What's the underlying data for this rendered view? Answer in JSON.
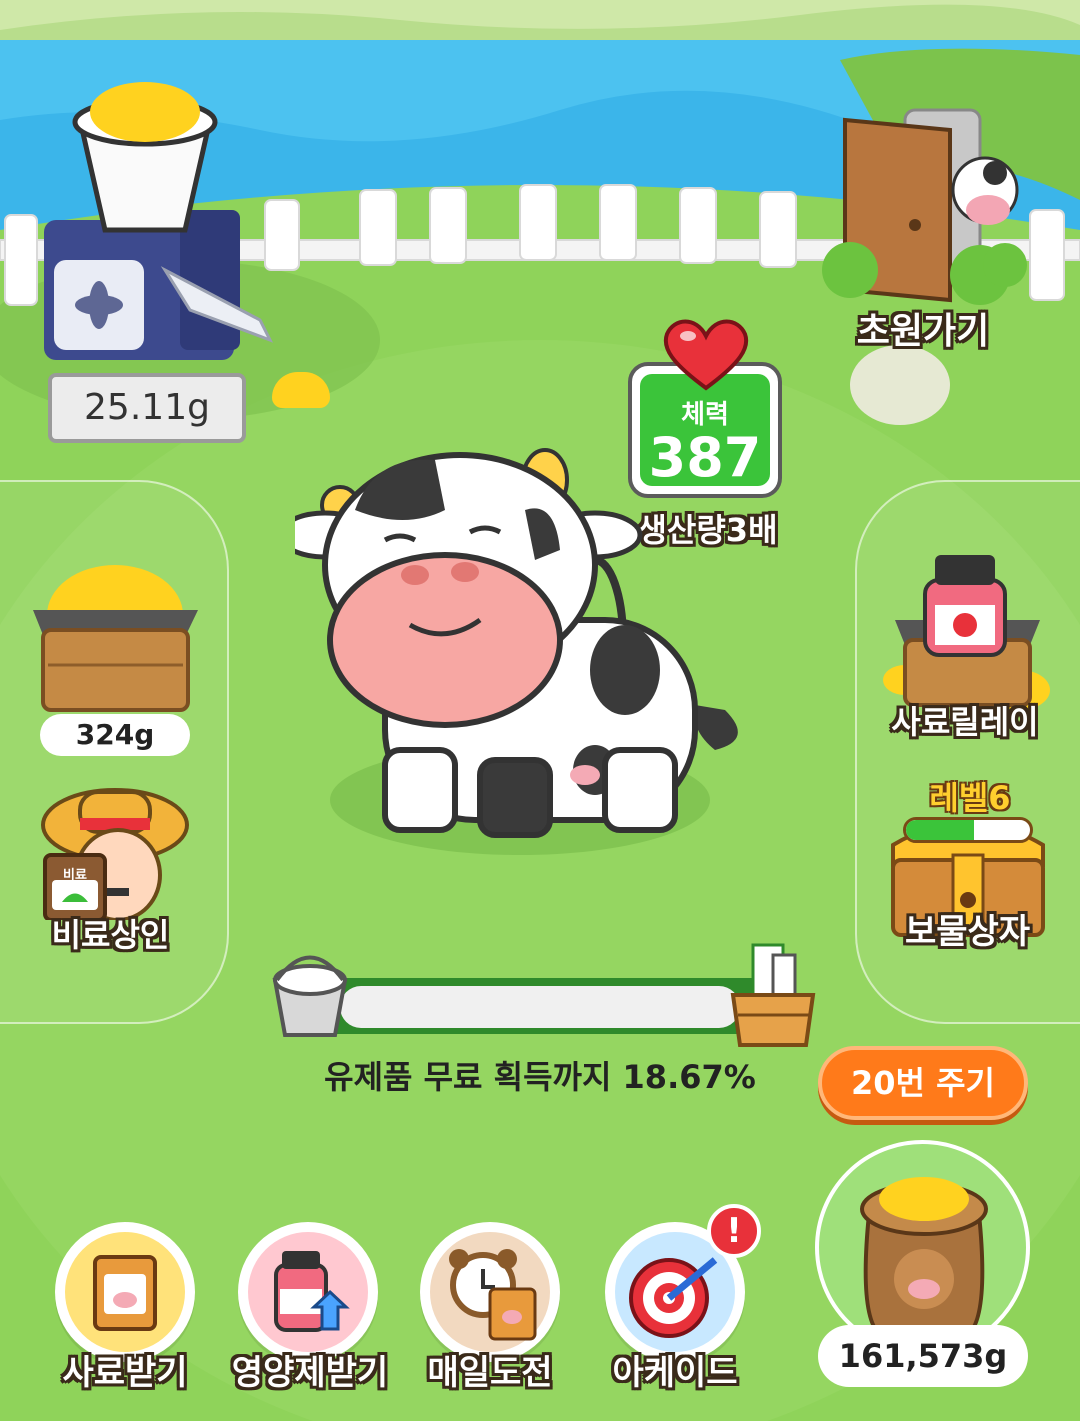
{
  "feeder": {
    "amount": "25.11g"
  },
  "stamina": {
    "label": "체력",
    "value": "387",
    "multiplier": "생산량3배"
  },
  "left": {
    "feed_box_amount": "324g",
    "fertilizer_merchant": {
      "bag_label": "비료",
      "label": "비료상인"
    }
  },
  "right": {
    "go_meadow": "초원가기",
    "feed_relay": "사료릴레이",
    "treasure": {
      "level": "레벨6",
      "label": "보물상자",
      "progress": 0.55
    }
  },
  "milk": {
    "progress_text": "유제품 무료 획득까지 18.67%",
    "progress": 0.1867
  },
  "give_button": "20번 주기",
  "feed_bag_total": "161,573g",
  "bottom_nav": [
    {
      "label": "사료받기",
      "icon": "feed-bag-icon"
    },
    {
      "label": "영양제받기",
      "icon": "supplement-icon"
    },
    {
      "label": "매일도전",
      "icon": "alarm-clock-icon"
    },
    {
      "label": "아케이드",
      "icon": "dartboard-icon",
      "alert": "!"
    }
  ],
  "colors": {
    "grass": "#8fd35a",
    "water": "#4cc2f0",
    "stamina_green": "#3bc43a",
    "give_orange": "#ff7a1a",
    "heart_red": "#e8313a"
  }
}
